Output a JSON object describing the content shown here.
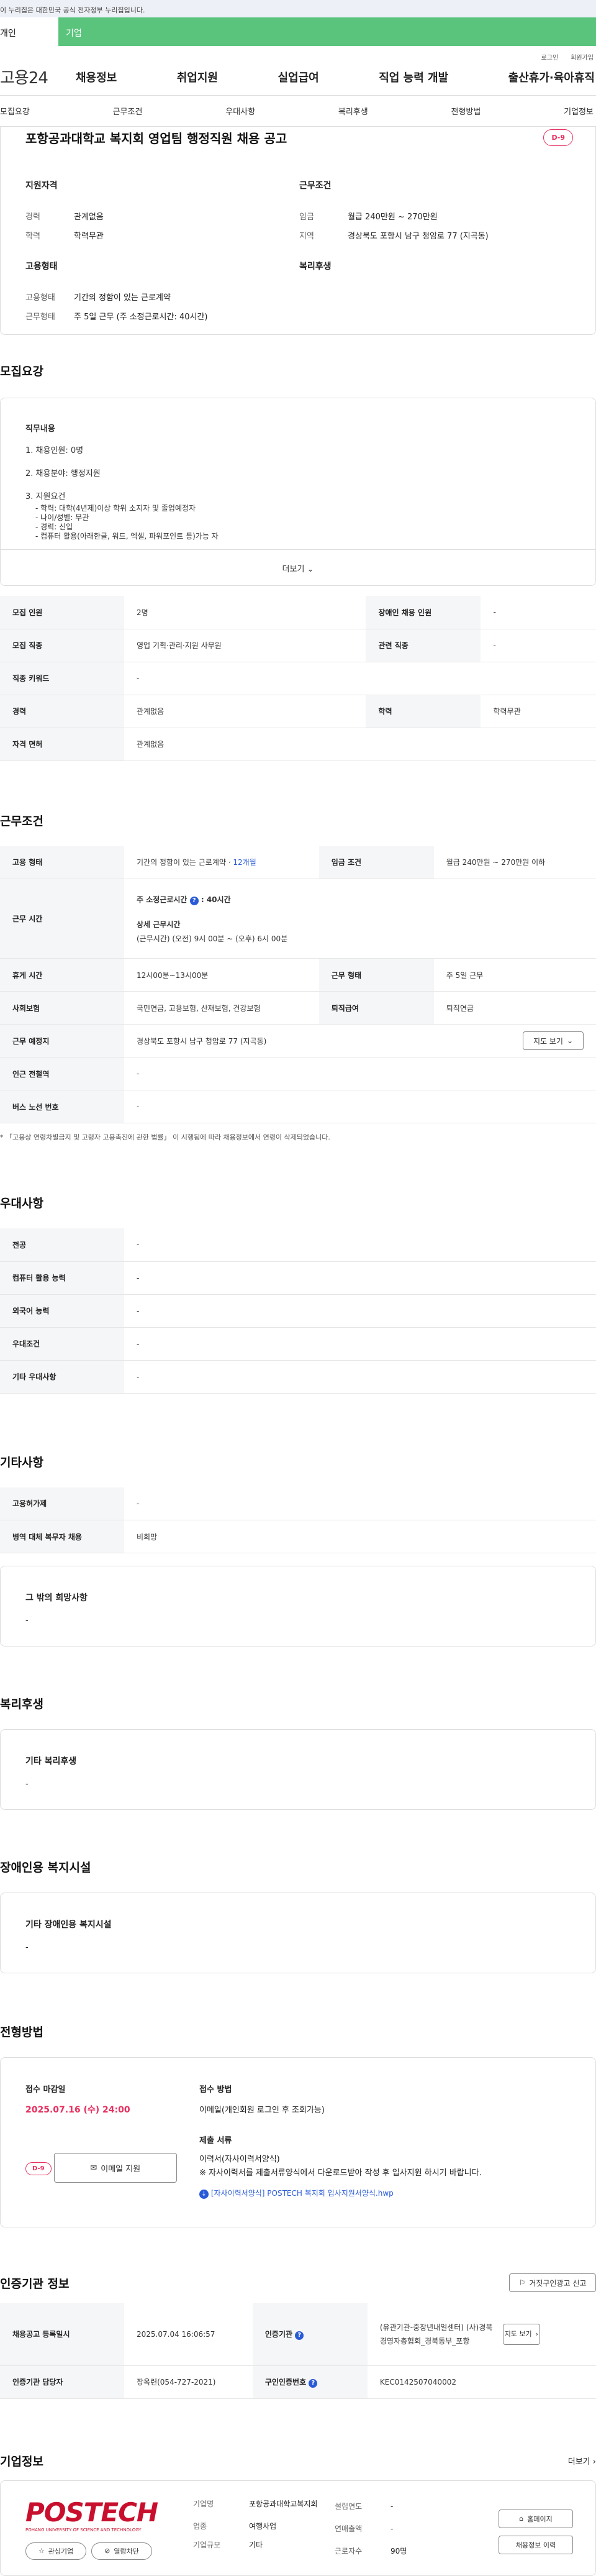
{
  "gov_notice": "이 누리집은 대한민국 공식 전자정부 누리집입니다.",
  "user_tabs": {
    "personal": "개인",
    "company": "기업"
  },
  "util": {
    "login": "로그인",
    "join": "회원가입"
  },
  "logo": "고용24",
  "gnb": [
    "채용정보",
    "취업지원",
    "실업급여",
    "직업 능력 개발",
    "출산휴가·육아휴직"
  ],
  "subnav": [
    "모집요강",
    "근무조건",
    "우대사항",
    "복리후생",
    "전형방법",
    "기업정보"
  ],
  "job": {
    "title": "포항공과대학교 복지회 영업팀 행정직원 채용 공고",
    "dday": "D-9",
    "qual_title": "지원자격",
    "qual": [
      {
        "k": "경력",
        "v": "관계없음"
      },
      {
        "k": "학력",
        "v": "학력무관"
      }
    ],
    "cond_title": "근무조건",
    "cond": [
      {
        "k": "임금",
        "v": "월급 240만원 ~ 270만원"
      },
      {
        "k": "지역",
        "v": "경상북도 포항시 남구 청암로 77 (지곡동)"
      }
    ],
    "emp_title": "고용형태",
    "emp": [
      {
        "k": "고용형태",
        "v": "기간의 정함이 있는 근로계약"
      },
      {
        "k": "근무형태",
        "v": "주 5일 근무 (주 소정근로시간: 40시간)"
      }
    ],
    "welfare_title": "복리후생"
  },
  "recruit": {
    "section_title": "모집요강",
    "desc_title": "직무내용",
    "desc_lines": [
      "1. 채용인원: 0명",
      "",
      "2. 채용분야: 행정지원",
      "",
      "3. 지원요건",
      "  - 학력: 대학(4년제)이상 학위 소지자 및 졸업예정자",
      "  - 나이/성별: 무관",
      "  - 경력: 신입",
      "  - 컴퓨터 활용(아래한글, 워드, 엑셀, 파워포인트 등)가능 자"
    ],
    "more": "더보기",
    "rows": [
      [
        {
          "k": "모집 인원"
        },
        {
          "v": "2명"
        },
        {
          "k": "장애인 채용 인원"
        },
        {
          "v": "-"
        }
      ],
      [
        {
          "k": "모집 직종"
        },
        {
          "v": "영업 기획·관리·지원 사무원"
        },
        {
          "k": "관련 직종"
        },
        {
          "v": "-"
        }
      ],
      [
        {
          "k": "직종 키워드"
        },
        {
          "v": "-"
        }
      ],
      [
        {
          "k": "경력"
        },
        {
          "v": "관계없음"
        },
        {
          "k": "학력"
        },
        {
          "v": "학력무관"
        }
      ],
      [
        {
          "k": "자격 면허"
        },
        {
          "v": "관계없음"
        }
      ]
    ]
  },
  "work": {
    "section_title": "근무조건",
    "emp_type_k": "고용 형태",
    "emp_type_v": "기간의 정함이 있는 근로계약",
    "emp_type_months": "12개월",
    "wage_k": "임금 조건",
    "wage_v": "월급 240만원 ~ 270만원 이하",
    "hours_k": "근무 시간",
    "hours_weekly": "주 소정근로시간",
    "hours_weekly_val": "40시간",
    "hours_detail_title": "상세 근무시간",
    "hours_detail": "(근무시간) (오전) 9시 00분 ~ (오후) 6시 00분",
    "break_k": "휴게 시간",
    "break_v": "12시00분~13시00분",
    "form_k": "근무 형태",
    "form_v": "주 5일 근무",
    "insur_k": "사회보험",
    "insur_v": "국민연금, 고용보험, 산재보험, 건강보험",
    "retire_k": "퇴직급여",
    "retire_v": "퇴직연금",
    "loc_k": "근무 예정지",
    "loc_v": "경상북도 포항시 남구 청암로 77 (지곡동)",
    "map_btn": "지도 보기",
    "subway_k": "인근 전철역",
    "subway_v": "-",
    "bus_k": "버스 노선 번호",
    "bus_v": "-",
    "note": "「고용상 연령차별금지 및 고령자 고용촉진에 관한 법률」 이 시행됨에 따라 채용정보에서 연령이 삭제되었습니다."
  },
  "pref": {
    "section_title": "우대사항",
    "rows": [
      {
        "k": "전공",
        "v": "-"
      },
      {
        "k": "컴퓨터 활용 능력",
        "v": "-"
      },
      {
        "k": "외국어 능력",
        "v": "-"
      },
      {
        "k": "우대조건",
        "v": "-"
      },
      {
        "k": "기타 우대사항",
        "v": "-"
      }
    ]
  },
  "etc": {
    "section_title": "기타사항",
    "rows": [
      {
        "k": "고용허가제",
        "v": "-"
      },
      {
        "k": "병역 대체 복무자 채용",
        "v": "비희망"
      }
    ],
    "box_title": "그 밖의 희망사항",
    "box_v": "-"
  },
  "benefit": {
    "section_title": "복리후생",
    "box_title": "기타 복리후생",
    "box_v": "-"
  },
  "disabled": {
    "section_title": "장애인용 복지시설",
    "box_title": "기타 장애인용 복지시설",
    "box_v": "-"
  },
  "select": {
    "section_title": "전형방법",
    "deadline_title": "접수 마감일",
    "deadline": "2025.07.16 (수) 24:00",
    "dday": "D-9",
    "email_btn": "이메일 지원",
    "method_title": "접수 방법",
    "method_v": "이메일(개인회원 로그인 후 조회가능)",
    "docs_title": "제출 서류",
    "docs_v1": "이력서(자사이력서양식)",
    "docs_v2": "※ 자사이력서를 제출서류양식에서 다운로드받아 작성 후 입사지원 하시기 바랍니다.",
    "file": "[자사이력서양식] POSTECH 복지회 입사지원서양식.hwp"
  },
  "agency": {
    "section_title": "인증기관 정보",
    "false_ad_btn": "거짓구인광고 신고",
    "reg_k": "채용공고 등록일시",
    "reg_v": "2025.07.04 16:06:57",
    "org_k": "인증기관",
    "org_v": "(유관기관-중장년내일센터) (사)경북경영자총협회_경북동부_포항",
    "map_btn": "지도 보기",
    "mgr_k": "인증기관 담당자",
    "mgr_v": "장옥련(054-727-2021)",
    "num_k": "구인인증번호",
    "num_v": "KEC0142507040002"
  },
  "company": {
    "section_title": "기업정보",
    "more": "더보기",
    "logo_text": "POSTECH",
    "logo_sub": "POHANG UNIVERSITY OF SCIENCE AND TECHNOLOGY",
    "fav_btn": "관심기업",
    "block_btn": "열람차단",
    "name_k": "기업명",
    "name_v": "포항공과대학교복지회",
    "ind_k": "업종",
    "ind_v": "여행사업",
    "size_k": "기업규모",
    "size_v": "기타",
    "est_k": "설립연도",
    "est_v": "-",
    "sales_k": "연매출액",
    "sales_v": "-",
    "emp_k": "근로자수",
    "emp_v": "90명",
    "home_btn": "홈페이지",
    "jobs_btn": "채용정보 이력"
  }
}
